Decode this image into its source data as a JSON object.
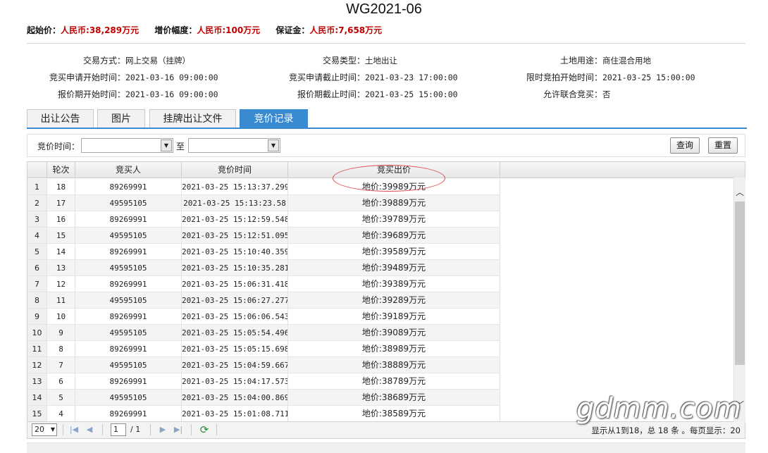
{
  "page": {
    "title": "WG2021-06"
  },
  "summary": [
    {
      "label": "起始价：",
      "value": "人民币:38,289万元"
    },
    {
      "label": "增价幅度：",
      "value": "人民币:100万元"
    },
    {
      "label": "保证金：",
      "value": "人民币:7,658万元"
    }
  ],
  "info": {
    "col1": [
      {
        "k": "交易方式：",
        "v": "网上交易（挂牌）"
      },
      {
        "k": "竞买申请开始时间：",
        "v": "2021-03-16 09:00:00"
      },
      {
        "k": "报价期开始时间：",
        "v": "2021-03-16 09:00:00"
      }
    ],
    "col2": [
      {
        "k": "交易类型：",
        "v": "土地出让"
      },
      {
        "k": "竞买申请截止时间：",
        "v": "2021-03-23 17:00:00"
      },
      {
        "k": "报价期截止时间：",
        "v": "2021-03-25 15:00:00"
      }
    ],
    "col3": [
      {
        "k": "土地用途：",
        "v": "商住混合用地"
      },
      {
        "k": "限时竞拍开始时间：",
        "v": "2021-03-25 15:00:00"
      },
      {
        "k": "允许联合竞买：",
        "v": "否"
      }
    ]
  },
  "tabs": [
    "出让公告",
    "图片",
    "挂牌出让文件",
    "竞价记录"
  ],
  "active_tab": 3,
  "filter": {
    "label": "竞价时间：",
    "to": "至",
    "query_btn": "查询",
    "reset_btn": "重置"
  },
  "grid": {
    "headers": [
      "轮次",
      "竞买人",
      "竞价时间",
      "竞买出价"
    ],
    "rows": [
      {
        "n": "1",
        "round": "18",
        "buyer": "89269991",
        "time": "2021-03-25 15:13:37.299",
        "price": "地价:39989万元"
      },
      {
        "n": "2",
        "round": "17",
        "buyer": "49595105",
        "time": "2021-03-25 15:13:23.58",
        "price": "地价:39889万元"
      },
      {
        "n": "3",
        "round": "16",
        "buyer": "89269991",
        "time": "2021-03-25 15:12:59.548",
        "price": "地价:39789万元"
      },
      {
        "n": "4",
        "round": "15",
        "buyer": "49595105",
        "time": "2021-03-25 15:12:51.095",
        "price": "地价:39689万元"
      },
      {
        "n": "5",
        "round": "14",
        "buyer": "89269991",
        "time": "2021-03-25 15:10:40.359",
        "price": "地价:39589万元"
      },
      {
        "n": "6",
        "round": "13",
        "buyer": "49595105",
        "time": "2021-03-25 15:10:35.281",
        "price": "地价:39489万元"
      },
      {
        "n": "7",
        "round": "12",
        "buyer": "89269991",
        "time": "2021-03-25 15:06:31.418",
        "price": "地价:39389万元"
      },
      {
        "n": "8",
        "round": "11",
        "buyer": "49595105",
        "time": "2021-03-25 15:06:27.277",
        "price": "地价:39289万元"
      },
      {
        "n": "9",
        "round": "10",
        "buyer": "89269991",
        "time": "2021-03-25 15:06:06.543",
        "price": "地价:39189万元"
      },
      {
        "n": "10",
        "round": "9",
        "buyer": "49595105",
        "time": "2021-03-25 15:05:54.496",
        "price": "地价:39089万元"
      },
      {
        "n": "11",
        "round": "8",
        "buyer": "89269991",
        "time": "2021-03-25 15:05:15.698",
        "price": "地价:38989万元"
      },
      {
        "n": "12",
        "round": "7",
        "buyer": "49595105",
        "time": "2021-03-25 15:04:59.667",
        "price": "地价:38889万元"
      },
      {
        "n": "13",
        "round": "6",
        "buyer": "89269991",
        "time": "2021-03-25 15:04:17.573",
        "price": "地价:38789万元"
      },
      {
        "n": "14",
        "round": "5",
        "buyer": "49595105",
        "time": "2021-03-25 15:04:00.869",
        "price": "地价:38689万元"
      },
      {
        "n": "15",
        "round": "4",
        "buyer": "89269991",
        "time": "2021-03-25 15:01:08.711",
        "price": "地价:38589万元"
      }
    ]
  },
  "pager": {
    "page_size": "20",
    "current_page": "1",
    "page_total": "/ 1",
    "summary": "显示从1到18，总 18 条 。每页显示：20"
  },
  "icons": {
    "first": "first-page-icon",
    "prev": "prev-page-icon",
    "next": "next-page-icon",
    "last": "last-page-icon",
    "refresh": "refresh-icon"
  },
  "watermark": "gdmm.com",
  "colors": {
    "accent": "#3a8ad2",
    "price_red": "#c00000",
    "annotation": "#e0464f"
  }
}
